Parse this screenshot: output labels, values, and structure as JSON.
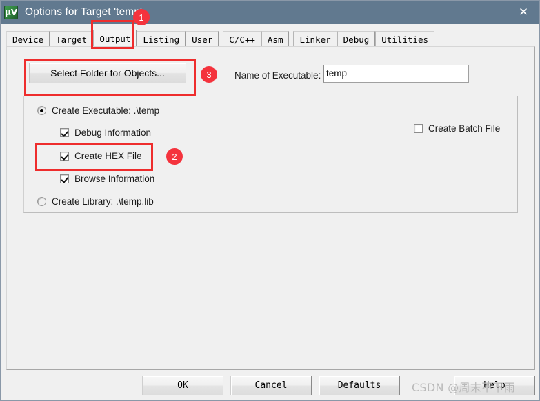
{
  "window": {
    "title": "Options for Target 'temp'",
    "icon": "keil-uvision-icon",
    "close_icon": "close-icon",
    "titlebar_color": "#61798f"
  },
  "tabs": [
    {
      "label": "Device",
      "active": false
    },
    {
      "label": "Target",
      "active": false
    },
    {
      "label": "Output",
      "active": true
    },
    {
      "label": "Listing",
      "active": false
    },
    {
      "label": "User",
      "active": false
    },
    {
      "label": "C/C++",
      "active": false
    },
    {
      "label": "Asm",
      "active": false
    },
    {
      "label": "Linker",
      "active": false
    },
    {
      "label": "Debug",
      "active": false
    },
    {
      "label": "Utilities",
      "active": false
    }
  ],
  "output_page": {
    "select_folder_button": "Select Folder for Objects...",
    "name_of_executable_label": "Name of Executable:",
    "name_of_executable_value": "temp",
    "name_of_executable_placeholder": "",
    "create_executable": {
      "label": "Create Executable:  .\\temp",
      "selected": true
    },
    "debug_information": {
      "label": "Debug Information",
      "checked": true
    },
    "create_hex_file": {
      "label": "Create HEX File",
      "checked": true
    },
    "browse_information": {
      "label": "Browse Information",
      "checked": true
    },
    "create_library": {
      "label": "Create Library:  .\\temp.lib",
      "selected": false
    },
    "create_batch_file": {
      "label": "Create Batch File",
      "checked": false
    }
  },
  "annotations": {
    "accent_color": "#ee2d2d",
    "badge_color": "#f4333d",
    "badges": [
      {
        "number": "1",
        "target": "output-tab"
      },
      {
        "number": "2",
        "target": "create-hex-file-row"
      },
      {
        "number": "3",
        "target": "select-folder-button"
      }
    ]
  },
  "footer": {
    "ok": "OK",
    "cancel": "Cancel",
    "defaults": "Defaults",
    "help": "Help"
  },
  "watermark": "CSDN @周末不下雨"
}
